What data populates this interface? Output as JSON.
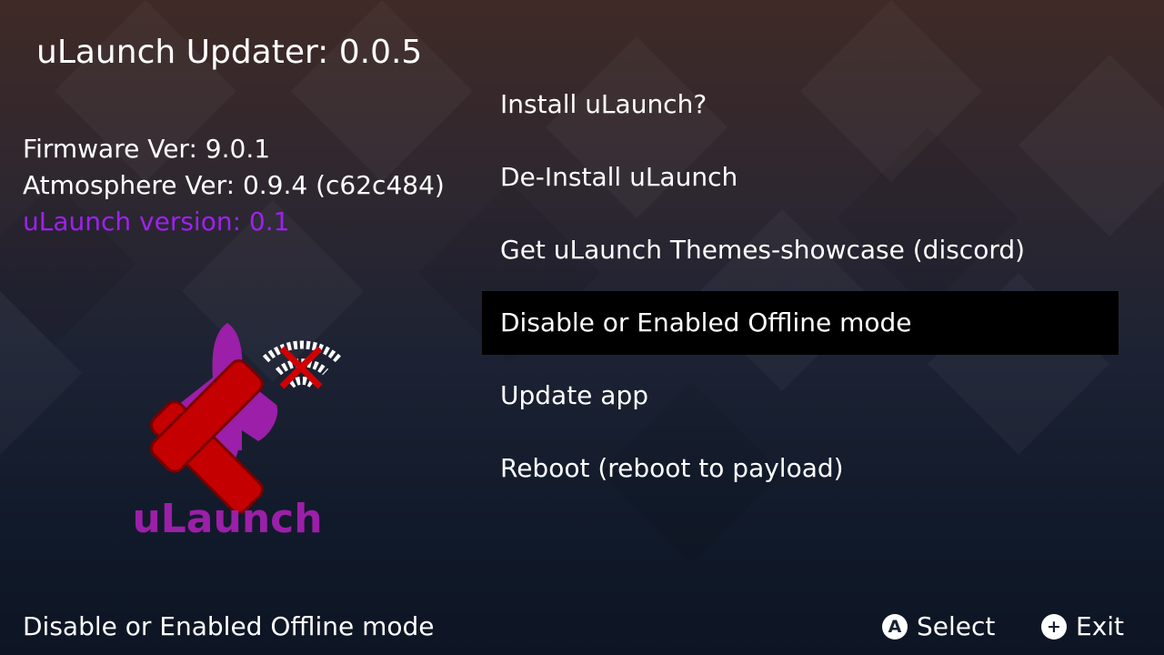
{
  "app": {
    "title": "uLaunch Updater: 0.0.5"
  },
  "info": {
    "firmware": "Firmware Ver: 9.0.1",
    "atmosphere": "Atmosphere Ver: 0.9.4 (c62c484)",
    "ulaunch_version": "uLaunch version: 0.1",
    "ulaunch_version_color": "#a020f0"
  },
  "logo": {
    "text": "uLaunch",
    "color": "#9b1fa8",
    "overlay_icon": "red-x-icon",
    "badge_icon": "wifi-off-icon"
  },
  "menu": {
    "selected_index": 3,
    "items": [
      {
        "label": "Install uLaunch?"
      },
      {
        "label": "De-Install uLaunch"
      },
      {
        "label": "Get uLaunch Themes-showcase (discord)"
      },
      {
        "label": "Disable or Enabled Offline mode"
      },
      {
        "label": "Update app"
      },
      {
        "label": "Reboot (reboot to payload)"
      }
    ]
  },
  "footer": {
    "description": "Disable or Enabled Offline mode",
    "hints": [
      {
        "icon": "A",
        "icon_name": "a-button-icon",
        "label": "Select"
      },
      {
        "icon": "+",
        "icon_name": "plus-button-icon",
        "label": "Exit"
      }
    ]
  }
}
